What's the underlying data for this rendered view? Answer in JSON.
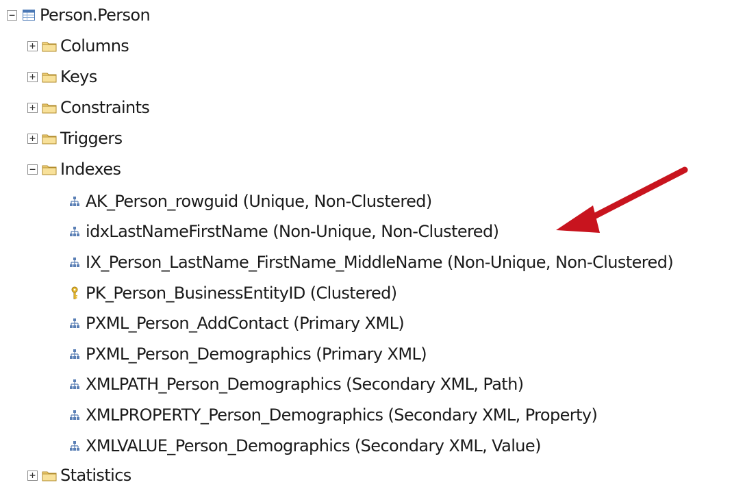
{
  "tree": {
    "root": {
      "label": "Person.Person",
      "expander": "−",
      "icon": "table-icon"
    },
    "folders_top": [
      {
        "label": "Columns",
        "expander": "+",
        "icon": "folder-icon"
      },
      {
        "label": "Keys",
        "expander": "+",
        "icon": "folder-icon"
      },
      {
        "label": "Constraints",
        "expander": "+",
        "icon": "folder-icon"
      },
      {
        "label": "Triggers",
        "expander": "+",
        "icon": "folder-icon"
      },
      {
        "label": "Indexes",
        "expander": "−",
        "icon": "folder-icon"
      }
    ],
    "indexes": [
      {
        "label": "AK_Person_rowguid (Unique, Non-Clustered)",
        "icon": "index-icon"
      },
      {
        "label": "idxLastNameFirstName (Non-Unique, Non-Clustered)",
        "icon": "index-icon"
      },
      {
        "label": "IX_Person_LastName_FirstName_MiddleName (Non-Unique, Non-Clustered)",
        "icon": "index-icon"
      },
      {
        "label": "PK_Person_BusinessEntityID (Clustered)",
        "icon": "key-icon"
      },
      {
        "label": "PXML_Person_AddContact (Primary XML)",
        "icon": "index-icon"
      },
      {
        "label": "PXML_Person_Demographics (Primary XML)",
        "icon": "index-icon"
      },
      {
        "label": "XMLPATH_Person_Demographics (Secondary XML, Path)",
        "icon": "index-icon"
      },
      {
        "label": "XMLPROPERTY_Person_Demographics (Secondary XML, Property)",
        "icon": "index-icon"
      },
      {
        "label": "XMLVALUE_Person_Demographics (Secondary XML, Value)",
        "icon": "index-icon"
      }
    ],
    "folders_bottom": [
      {
        "label": "Statistics",
        "expander": "+",
        "icon": "folder-icon"
      }
    ]
  },
  "annotation": {
    "icon": "red-arrow-icon",
    "color": "#c8141e",
    "points_to": "idxLastNameFirstName (Non-Unique, Non-Clustered)"
  }
}
